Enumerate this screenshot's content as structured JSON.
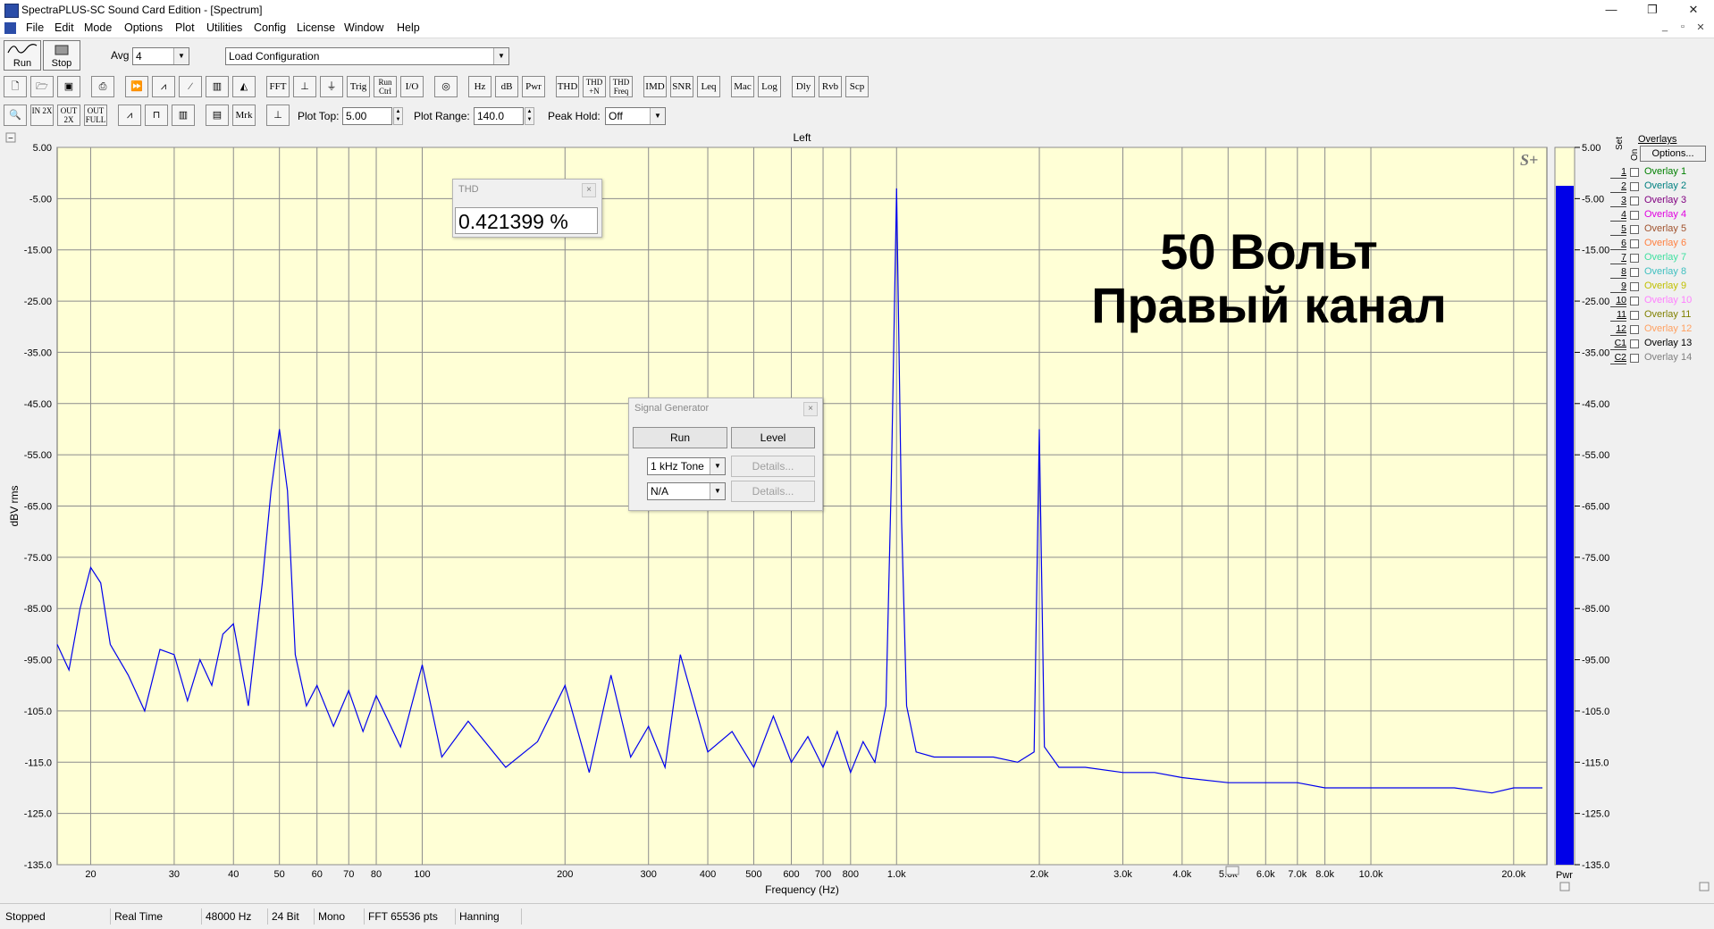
{
  "window": {
    "title": "SpectraPLUS-SC Sound Card Edition - [Spectrum]",
    "controls": {
      "minimize": "—",
      "restore": "❐",
      "close": "✕"
    },
    "mdi_controls": {
      "minimize": "_",
      "restore": "▫",
      "close": "✕"
    }
  },
  "menu": [
    "File",
    "Edit",
    "Mode",
    "Options",
    "Plot",
    "Utilities",
    "Config",
    "License",
    "Window",
    "Help"
  ],
  "toolbar1": {
    "run_label": "Run",
    "stop_label": "Stop",
    "avg_label": "Avg",
    "avg_value": "4",
    "config_value": "Load Configuration"
  },
  "toolbar2": {
    "buttons": [
      "FFT",
      "",
      "Trig",
      "Run Ctrl",
      "I/O",
      "",
      "Hz",
      "dB",
      "Pwr",
      "THD",
      "THD +N",
      "THD Freq",
      "IMD",
      "SNR",
      "Leq",
      "Mac",
      "Log",
      "Dly",
      "Rvb",
      "Scp"
    ]
  },
  "toolbar3": {
    "zoom_buttons": [
      "IN 2X",
      "OUT 2X",
      "OUT FULL"
    ],
    "mrk_label": "Mrk",
    "plot_top_label": "Plot Top:",
    "plot_top_value": "5.00",
    "plot_range_label": "Plot Range:",
    "plot_range_value": "140.0",
    "peak_hold_label": "Peak Hold:",
    "peak_hold_value": "Off"
  },
  "plot": {
    "channel_label": "Left",
    "logo": "S+",
    "annotation_line1": "50 Вольт",
    "annotation_line2": "Правый канал",
    "colors": {
      "background": "#ffffd6",
      "grid": "#8c8c8c",
      "trace": "#0000ee",
      "bar": "#0000e8"
    }
  },
  "chart_data": {
    "type": "line",
    "xlabel": "Frequency (Hz)",
    "ylabel": "dBV rms",
    "xscale": "log",
    "xlim": [
      17,
      23500
    ],
    "ylim": [
      -135,
      5
    ],
    "x_ticks": [
      "20",
      "30",
      "40",
      "50",
      "60",
      "70",
      "80",
      "100",
      "200",
      "300",
      "400",
      "500",
      "600",
      "700",
      "800",
      "1.0k",
      "2.0k",
      "3.0k",
      "4.0k",
      "5.0k",
      "6.0k",
      "7.0k",
      "8.0k",
      "10.0k",
      "20.0k"
    ],
    "y_ticks": [
      "5.00",
      "-5.00",
      "-15.00",
      "-25.00",
      "-35.00",
      "-45.00",
      "-55.00",
      "-65.00",
      "-75.00",
      "-85.00",
      "-95.00",
      "-105.0",
      "-115.0",
      "-125.0",
      "-135.0"
    ],
    "grid": true,
    "series": [
      {
        "x": [
          17,
          18,
          19,
          20,
          21,
          22,
          24,
          26,
          28,
          30,
          32,
          34,
          36,
          38,
          40,
          43,
          46,
          48,
          50,
          52,
          54,
          57,
          60,
          65,
          70,
          75,
          80,
          90,
          100,
          110,
          125,
          150,
          175,
          200,
          225,
          250,
          275,
          300,
          325,
          350,
          400,
          450,
          500,
          550,
          600,
          650,
          700,
          750,
          800,
          850,
          900,
          950,
          975,
          1000,
          1025,
          1050,
          1100,
          1200,
          1400,
          1600,
          1800,
          1950,
          2000,
          2050,
          2200,
          2500,
          3000,
          3500,
          4000,
          5000,
          6000,
          7000,
          8000,
          10000,
          12000,
          15000,
          18000,
          20000,
          23000
        ],
        "y": [
          -92,
          -97,
          -85,
          -77,
          -80,
          -92,
          -98,
          -105,
          -93,
          -94,
          -103,
          -95,
          -100,
          -90,
          -88,
          -104,
          -80,
          -62,
          -50,
          -62,
          -94,
          -104,
          -100,
          -108,
          -101,
          -109,
          -102,
          -112,
          -96,
          -114,
          -107,
          -116,
          -111,
          -100,
          -117,
          -98,
          -114,
          -108,
          -116,
          -94,
          -113,
          -109,
          -116,
          -106,
          -115,
          -110,
          -116,
          -109,
          -117,
          -111,
          -115,
          -104,
          -60,
          -3,
          -68,
          -104,
          -113,
          -114,
          -114,
          -114,
          -115,
          -113,
          -50,
          -112,
          -116,
          -116,
          -117,
          -117,
          -118,
          -119,
          -119,
          -119,
          -120,
          -120,
          -120,
          -120,
          -121,
          -120,
          -120
        ]
      }
    ]
  },
  "thd_window": {
    "title": "THD",
    "value": "0.421399 %"
  },
  "siggen_window": {
    "title": "Signal Generator",
    "run_label": "Run",
    "level_label": "Level",
    "tone_value": "1 kHz Tone",
    "na_value": "N/A",
    "details_label": "Details..."
  },
  "level_meter": {
    "ticks": [
      "5.00",
      "-5.00",
      "-15.00",
      "-25.00",
      "-35.00",
      "-45.00",
      "-55.00",
      "-65.00",
      "-75.00",
      "-85.00",
      "-95.00",
      "-105.0",
      "-115.0",
      "-125.0",
      "-135.0"
    ],
    "level_db": -2.5,
    "label": "Pwr"
  },
  "overlays": {
    "header": "Overlays",
    "set_label": "Set",
    "on_label": "On",
    "options_label": "Options...",
    "items": [
      {
        "num": "1",
        "name": "Overlay 1",
        "color": "#008000"
      },
      {
        "num": "2",
        "name": "Overlay 2",
        "color": "#008080"
      },
      {
        "num": "3",
        "name": "Overlay 3",
        "color": "#800080"
      },
      {
        "num": "4",
        "name": "Overlay 4",
        "color": "#e000e0"
      },
      {
        "num": "5",
        "name": "Overlay 5",
        "color": "#a0522d"
      },
      {
        "num": "6",
        "name": "Overlay 6",
        "color": "#ff8040"
      },
      {
        "num": "7",
        "name": "Overlay 7",
        "color": "#40e0a0"
      },
      {
        "num": "8",
        "name": "Overlay 8",
        "color": "#40c0c0"
      },
      {
        "num": "9",
        "name": "Overlay 9",
        "color": "#c0c000"
      },
      {
        "num": "10",
        "name": "Overlay 10",
        "color": "#ff80ff"
      },
      {
        "num": "11",
        "name": "Overlay 11",
        "color": "#808000"
      },
      {
        "num": "12",
        "name": "Overlay 12",
        "color": "#ffa060"
      },
      {
        "num": "C1",
        "name": "Overlay 13",
        "color": "#000000"
      },
      {
        "num": "C2",
        "name": "Overlay 14",
        "color": "#808080"
      }
    ]
  },
  "status": [
    "Stopped",
    "Real Time",
    "48000 Hz",
    "24 Bit",
    "Mono",
    "FFT 65536 pts",
    "Hanning"
  ]
}
